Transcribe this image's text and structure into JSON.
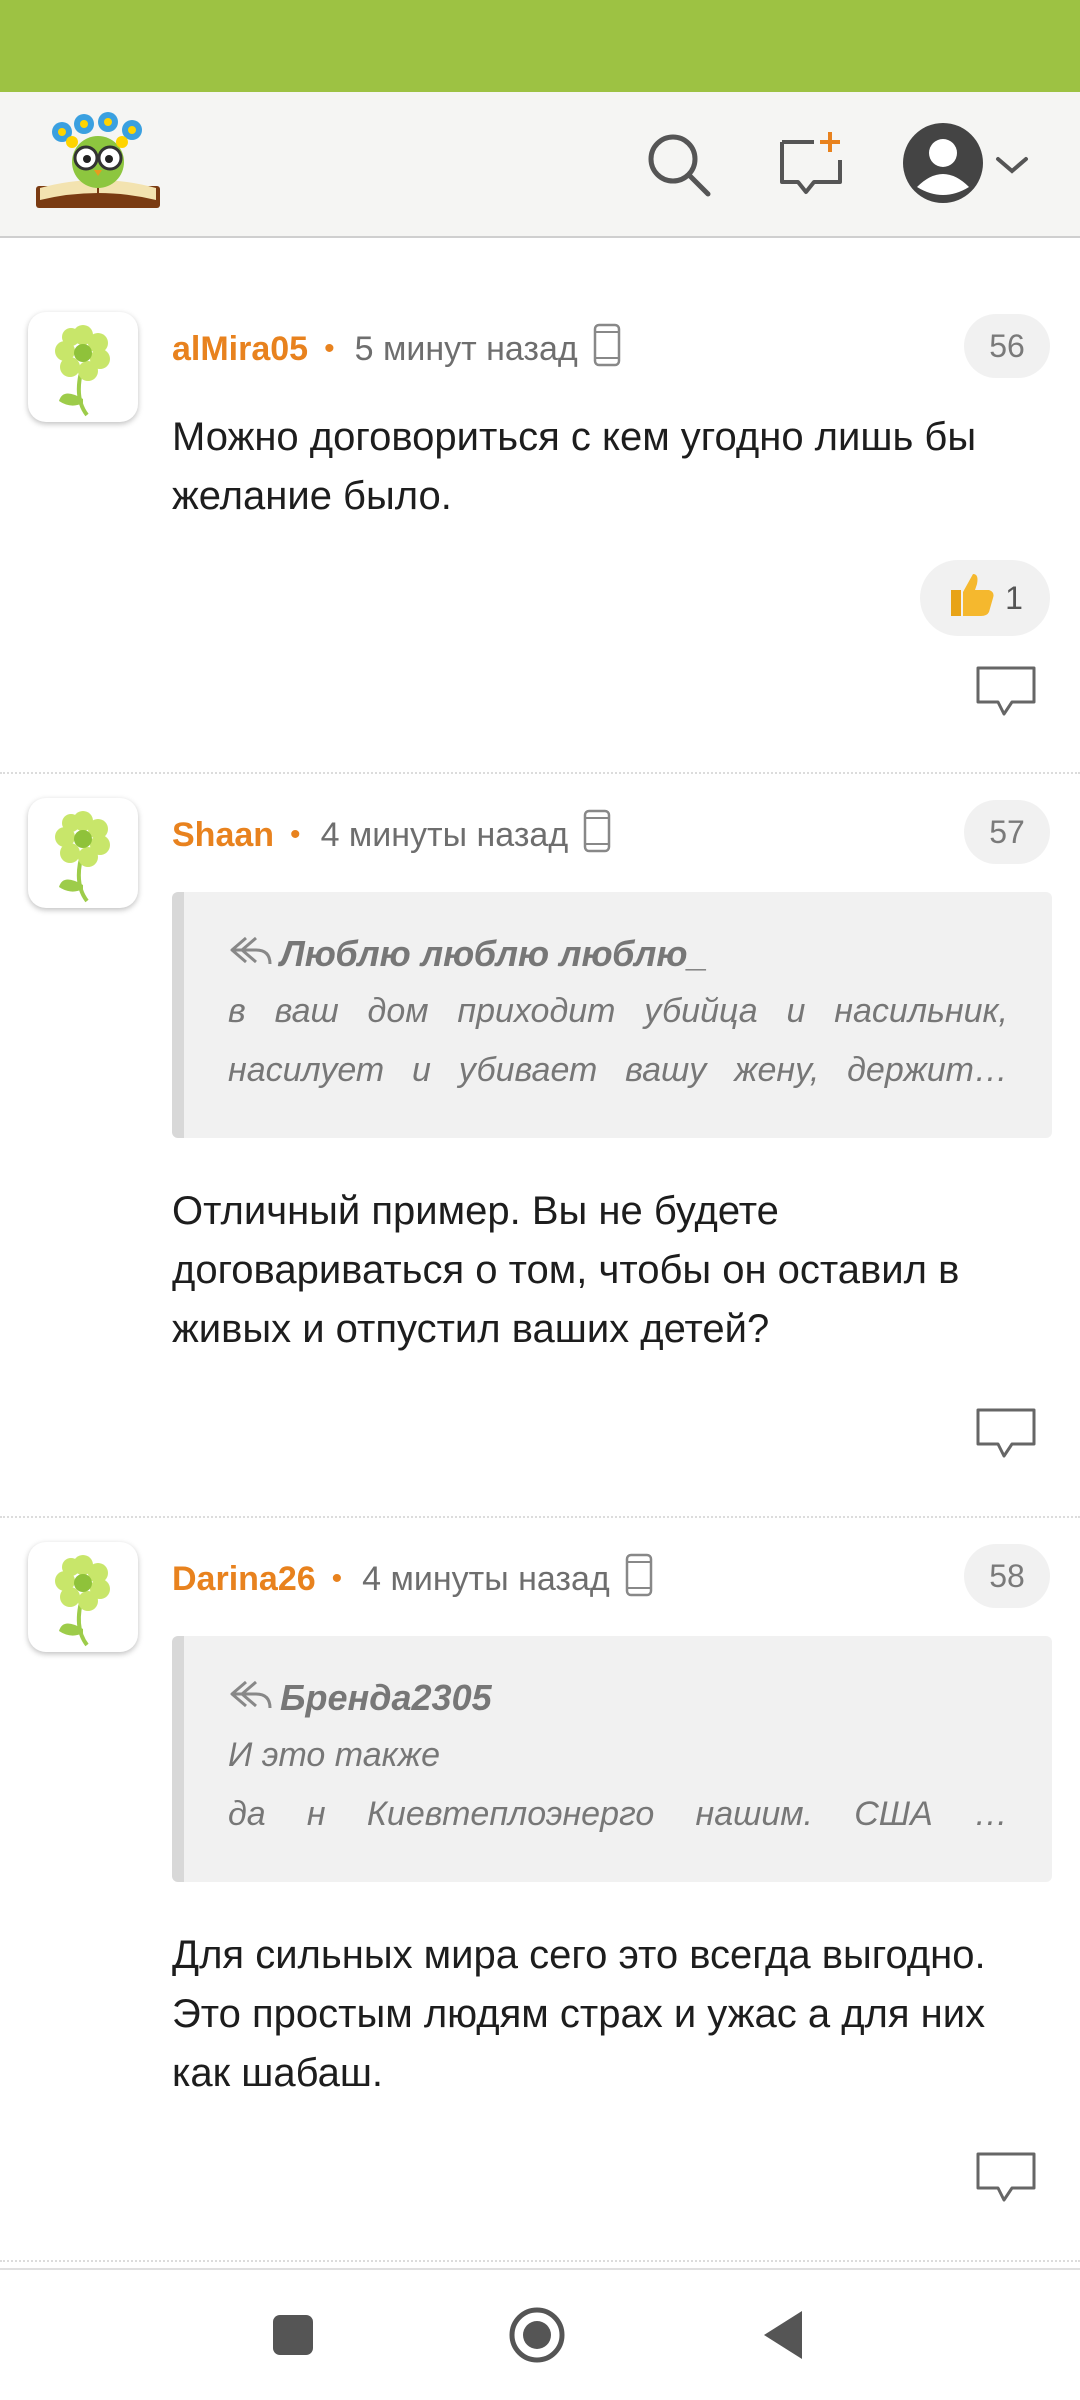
{
  "header": {
    "logo": "owl-book-logo",
    "icons": [
      "search-icon",
      "new-post-icon",
      "avatar-icon",
      "chevron-down-icon"
    ]
  },
  "comments": [
    {
      "author": "alMira05",
      "time": "5 минут назад",
      "number": "56",
      "text": "Можно договориться с кем угодно лишь бы желание было.",
      "likes": "1"
    },
    {
      "author": "Shaan",
      "time": "4 минуты назад",
      "number": "57",
      "quote_author": "Люблю люблю люблю_",
      "quote_lines": [
        "в ваш дом приходит убийца и насильник,",
        "насилует и убивает вашу жену, держит…"
      ],
      "text": "Отличный пример. Вы не будете договариваться о том, чтобы он оставил в живых и отпустил ваших детей?"
    },
    {
      "author": "Darina26",
      "time": "4 минуты назад",
      "number": "58",
      "quote_author": "Бренда2305",
      "quote_lines": [
        "И это также",
        "да н Киевтеплоэнерго нашим. США …"
      ],
      "text": "Для сильных мира сего это всегда выгодно. Это простым людям страх и ужас а для них как шабаш."
    }
  ],
  "colors": {
    "status_bar": "#9dc243",
    "author": "#e8821e",
    "header_bg": "#f5f5f3"
  }
}
